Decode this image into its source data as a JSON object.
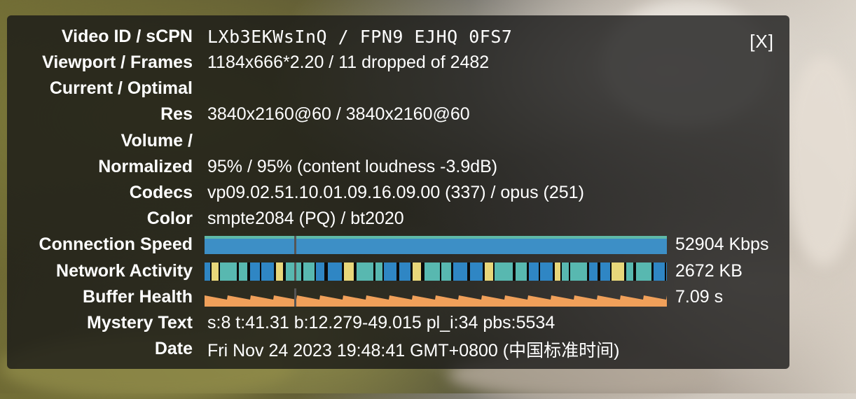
{
  "stats": {
    "video_id": {
      "label": "Video ID / sCPN",
      "value": "LXb3EKWsInQ / FPN9 EJHQ 0FS7"
    },
    "viewport": {
      "label": "Viewport / Frames",
      "value": "1184x666*2.20 / 11 dropped of 2482"
    },
    "current_optimal": {
      "label": "Current / Optimal",
      "value": ""
    },
    "res": {
      "label": "Res",
      "value": "3840x2160@60 / 3840x2160@60"
    },
    "volume": {
      "label": "Volume /",
      "value": ""
    },
    "normalized": {
      "label": "Normalized",
      "value": "95% / 95% (content loudness -3.9dB)"
    },
    "codecs": {
      "label": "Codecs",
      "value": "vp09.02.51.10.01.09.16.09.00 (337) / opus (251)"
    },
    "color": {
      "label": "Color",
      "value": "smpte2084 (PQ) / bt2020"
    },
    "connection_speed": {
      "label": "Connection Speed",
      "value": "52904 Kbps"
    },
    "network_activity": {
      "label": "Network Activity",
      "value": "2672 KB"
    },
    "buffer_health": {
      "label": "Buffer Health",
      "value": "7.09 s"
    },
    "mystery_text": {
      "label": "Mystery Text",
      "value": "s:8 t:41.31 b:12.279-49.015 pl_i:34 pbs:5534"
    },
    "date": {
      "label": "Date",
      "value": "Fri Nov 24 2023 19:48:41 GMT+0800 (中国标准时间)"
    }
  },
  "close_label": "[X]",
  "colors": {
    "connection_bar": "#3d8fc6",
    "connection_top": "#5fb9a8",
    "network_blue": "#2f86c4",
    "network_yellow": "#e8d77a",
    "network_teal": "#58b8b0",
    "buffer_orange": "#f0a05a"
  }
}
